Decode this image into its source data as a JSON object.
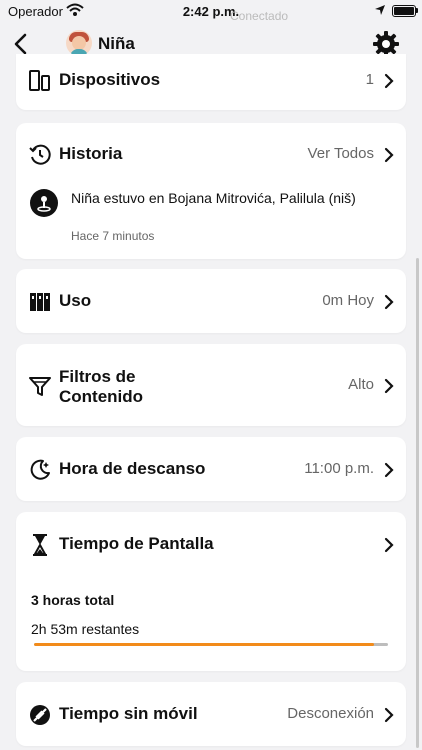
{
  "status_bar": {
    "carrier": "Operador",
    "time": "2:42 p.m.",
    "ghost_text": "Conectado"
  },
  "header": {
    "child_name": "Niña",
    "back_icon": "chevron-left-icon",
    "settings_icon": "gear-icon"
  },
  "devices": {
    "label": "Dispositivos",
    "value": "1"
  },
  "history": {
    "label": "Historia",
    "action": "Ver Todos",
    "item_prefix": "Niña estuvo en ",
    "item_place": "Bojana Mitrovića, Palilula (niš)",
    "item_time": "Hace 7 minutos"
  },
  "usage": {
    "label": "Uso",
    "value": "0m Hoy"
  },
  "content_filters": {
    "label_line1": "Filtros de",
    "label_line2": "Contenido",
    "value": "Alto"
  },
  "bedtime": {
    "label": "Hora de descanso",
    "value": "11:00 p.m."
  },
  "screen_time": {
    "label": "Tiempo de Pantalla",
    "total": "3 horas total",
    "remaining": "2h 53m restantes",
    "progress_percent": 96,
    "progress_color": "#f28b1a"
  },
  "offline_time": {
    "label": "Tiempo sin móvil",
    "value": "Desconexión"
  }
}
